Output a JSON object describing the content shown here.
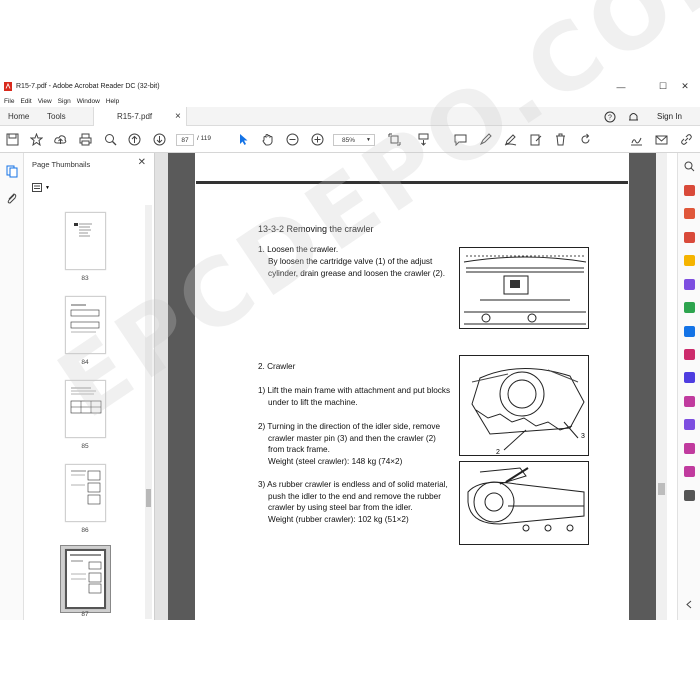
{
  "window": {
    "title": "R15-7.pdf - Adobe Acrobat Reader DC (32-bit)",
    "minimize": "—",
    "maximize": "☐",
    "close": "✕"
  },
  "menu": [
    "File",
    "Edit",
    "View",
    "Sign",
    "Window",
    "Help"
  ],
  "tabs": {
    "home": "Home",
    "tools": "Tools",
    "document": "R15-7.pdf",
    "close": "×",
    "sign_in": "Sign In"
  },
  "toolbar": {
    "current_page": "87",
    "total_pages": "/ 119",
    "zoom": "85%"
  },
  "thumbnails": {
    "header": "Page Thumbnails",
    "close": "✕",
    "pages": [
      "83",
      "84",
      "85",
      "86",
      "87"
    ],
    "selected": "87"
  },
  "document": {
    "section_title": "13-3-2 Removing the crawler",
    "step1_title": "1. Loosen the crawler.",
    "step1_line1": "By loosen the cartridge valve (1) of the adjust",
    "step1_line2": "cylinder, drain grease and loosen the crawler (2).",
    "step2_title": "2. Crawler",
    "sub1_line1": "1) Lift the main frame with attachment and put blocks",
    "sub1_line2": "under to lift the machine.",
    "sub2_line1": "2) Turning in the direction of the idler side, remove",
    "sub2_line2": "crawler master pin (3) and then the crawler (2)",
    "sub2_line3": "from track frame.",
    "sub2_line4": "Weight (steel crawler):  148 kg (74×2)",
    "sub3_line1": "3) As rubber crawler is endless and of solid material,",
    "sub3_line2": "push the idler to the end and remove the rubber",
    "sub3_line3": "crawler by using steel bar from the idler.",
    "sub3_line4": "Weight (rubber crawler):  102 kg (51×2)",
    "fig2_label2": "2",
    "fig2_label3": "3"
  },
  "watermark": "EPCDEPO.COM",
  "colors": {
    "accent": "#1473e6",
    "close_red": "#d9291c",
    "thumb_icon_red": "#cc2b2b"
  }
}
